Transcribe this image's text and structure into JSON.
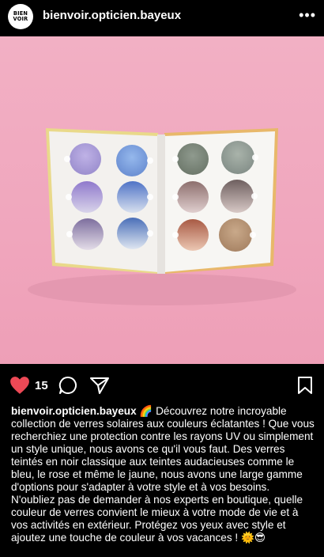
{
  "post": {
    "avatar": {
      "line1": "BIEN",
      "line2": "VOIR"
    },
    "username": "bienvoir.opticien.bayeux",
    "more_icon": "more-horizontal-icon",
    "photo_alt": "sunglass-lens-color-sample-case",
    "likes": "15",
    "icons": [
      "heart-filled-icon",
      "comment-icon",
      "share-icon",
      "bookmark-icon"
    ],
    "caption_username": "bienvoir.opticien.bayeux",
    "caption_text": " 🌈 Découvrez notre incroyable collection de verres solaires aux couleurs éclatantes ! Que vous recherchiez une protection contre les rayons UV ou simplement un style unique, nous avons ce qu'il vous faut. Des verres teintés en noir classique aux teintes audacieuses comme le bleu, le rose et même le jaune, nous avons une large gamme d'options pour s'adapter à votre style et à vos besoins. N'oubliez pas de demander à nos experts en boutique, quelle couleur de verres convient le mieux à votre mode de vie et à vos activités en extérieur. Protégez vos yeux avec style et ajoutez une touche de couleur à vos vacances ! 🌞😎"
  },
  "colors": {
    "background": "#000000",
    "heart": "#ed4956",
    "photo_background": "#f0a8be"
  }
}
